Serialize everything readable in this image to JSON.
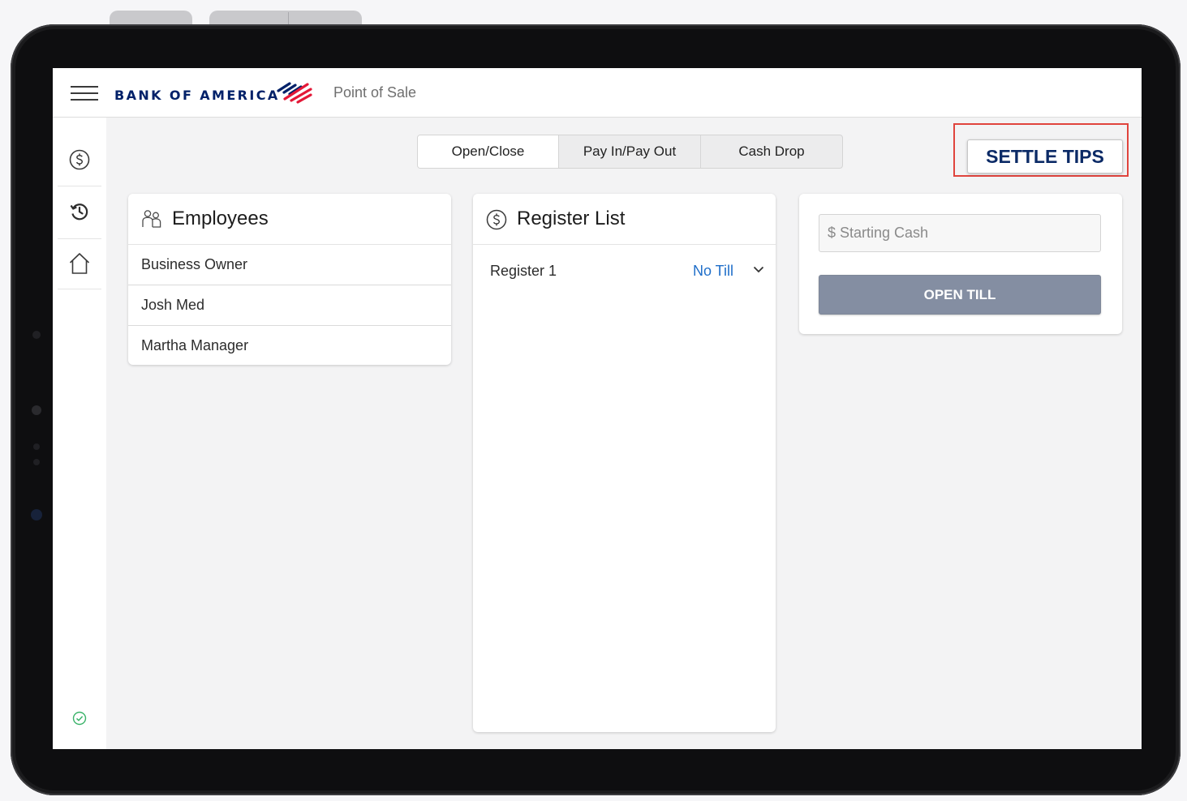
{
  "brand": {
    "name": "BANK OF AMERICA",
    "app_title": "Point of Sale",
    "colors": {
      "navy": "#012169",
      "red": "#e31837"
    }
  },
  "icons": {
    "menu": "hamburger-menu-icon",
    "sidebar": [
      "dollar-circle-icon",
      "history-icon",
      "home-icon"
    ],
    "status": "check-circle-icon",
    "employees": "people-icon",
    "register": "dollar-circle-icon",
    "dropdown": "chevron-down-icon"
  },
  "tabs": [
    {
      "label": "Open/Close",
      "active": true
    },
    {
      "label": "Pay In/Pay Out",
      "active": false
    },
    {
      "label": "Cash Drop",
      "active": false
    }
  ],
  "settle_tips": {
    "label": "SETTLE TIPS",
    "highlight_color": "#e0443d"
  },
  "employees": {
    "title": "Employees",
    "items": [
      "Business Owner",
      "Josh Med",
      "Martha Manager"
    ]
  },
  "register_list": {
    "title": "Register List",
    "items": [
      {
        "name": "Register 1",
        "status": "No Till",
        "status_color": "#1f6ec9"
      }
    ]
  },
  "till": {
    "starting_cash_placeholder": "$ Starting Cash",
    "starting_cash_value": "",
    "open_button": "OPEN TILL",
    "button_color": "#848ea2"
  }
}
